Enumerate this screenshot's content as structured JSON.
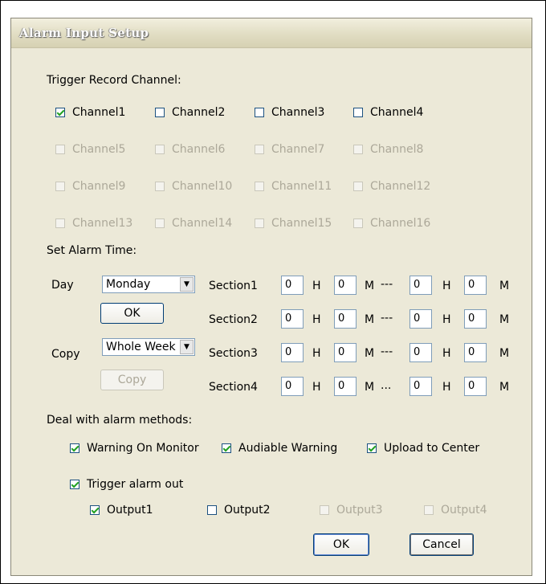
{
  "dialog": {
    "title": "Alarm Input Setup"
  },
  "trigger": {
    "heading": "Trigger Record Channel:",
    "channels": [
      {
        "label": "Channel1",
        "checked": true,
        "enabled": true
      },
      {
        "label": "Channel2",
        "checked": false,
        "enabled": true
      },
      {
        "label": "Channel3",
        "checked": false,
        "enabled": true
      },
      {
        "label": "Channel4",
        "checked": false,
        "enabled": true
      },
      {
        "label": "Channel5",
        "checked": false,
        "enabled": false
      },
      {
        "label": "Channel6",
        "checked": false,
        "enabled": false
      },
      {
        "label": "Channel7",
        "checked": false,
        "enabled": false
      },
      {
        "label": "Channel8",
        "checked": false,
        "enabled": false
      },
      {
        "label": "Channel9",
        "checked": false,
        "enabled": false
      },
      {
        "label": "Channel10",
        "checked": false,
        "enabled": false
      },
      {
        "label": "Channel11",
        "checked": false,
        "enabled": false
      },
      {
        "label": "Channel12",
        "checked": false,
        "enabled": false
      },
      {
        "label": "Channel13",
        "checked": false,
        "enabled": false
      },
      {
        "label": "Channel14",
        "checked": false,
        "enabled": false
      },
      {
        "label": "Channel15",
        "checked": false,
        "enabled": false
      },
      {
        "label": "Channel16",
        "checked": false,
        "enabled": false
      }
    ]
  },
  "alarm_time": {
    "heading": "Set Alarm Time:",
    "day_label": "Day",
    "day_value": "Monday",
    "ok_label": "OK",
    "copy_label": "Copy",
    "copy_value": "Whole Week",
    "copy_button": "Copy",
    "h_unit": "H",
    "m_unit": "M",
    "sections": [
      {
        "label": "Section1",
        "start_h": "0",
        "start_m": "0",
        "sep": "---",
        "end_h": "0",
        "end_m": "0"
      },
      {
        "label": "Section2",
        "start_h": "0",
        "start_m": "0",
        "sep": "---",
        "end_h": "0",
        "end_m": "0"
      },
      {
        "label": "Section3",
        "start_h": "0",
        "start_m": "0",
        "sep": "---",
        "end_h": "0",
        "end_m": "0"
      },
      {
        "label": "Section4",
        "start_h": "0",
        "start_m": "0",
        "sep": "...",
        "end_h": "0",
        "end_m": "0"
      }
    ]
  },
  "methods": {
    "heading": "Deal with alarm methods:",
    "warning_monitor": {
      "label": "Warning On Monitor",
      "checked": true
    },
    "audiable": {
      "label": "Audiable Warning",
      "checked": true
    },
    "upload": {
      "label": "Upload to Center",
      "checked": true
    },
    "trigger_out": {
      "label": "Trigger alarm out",
      "checked": true
    },
    "outputs": [
      {
        "label": "Output1",
        "checked": true,
        "enabled": true
      },
      {
        "label": "Output2",
        "checked": false,
        "enabled": true
      },
      {
        "label": "Output3",
        "checked": false,
        "enabled": false
      },
      {
        "label": "Output4",
        "checked": false,
        "enabled": false
      }
    ]
  },
  "footer": {
    "ok_label": "OK",
    "cancel_label": "Cancel"
  }
}
